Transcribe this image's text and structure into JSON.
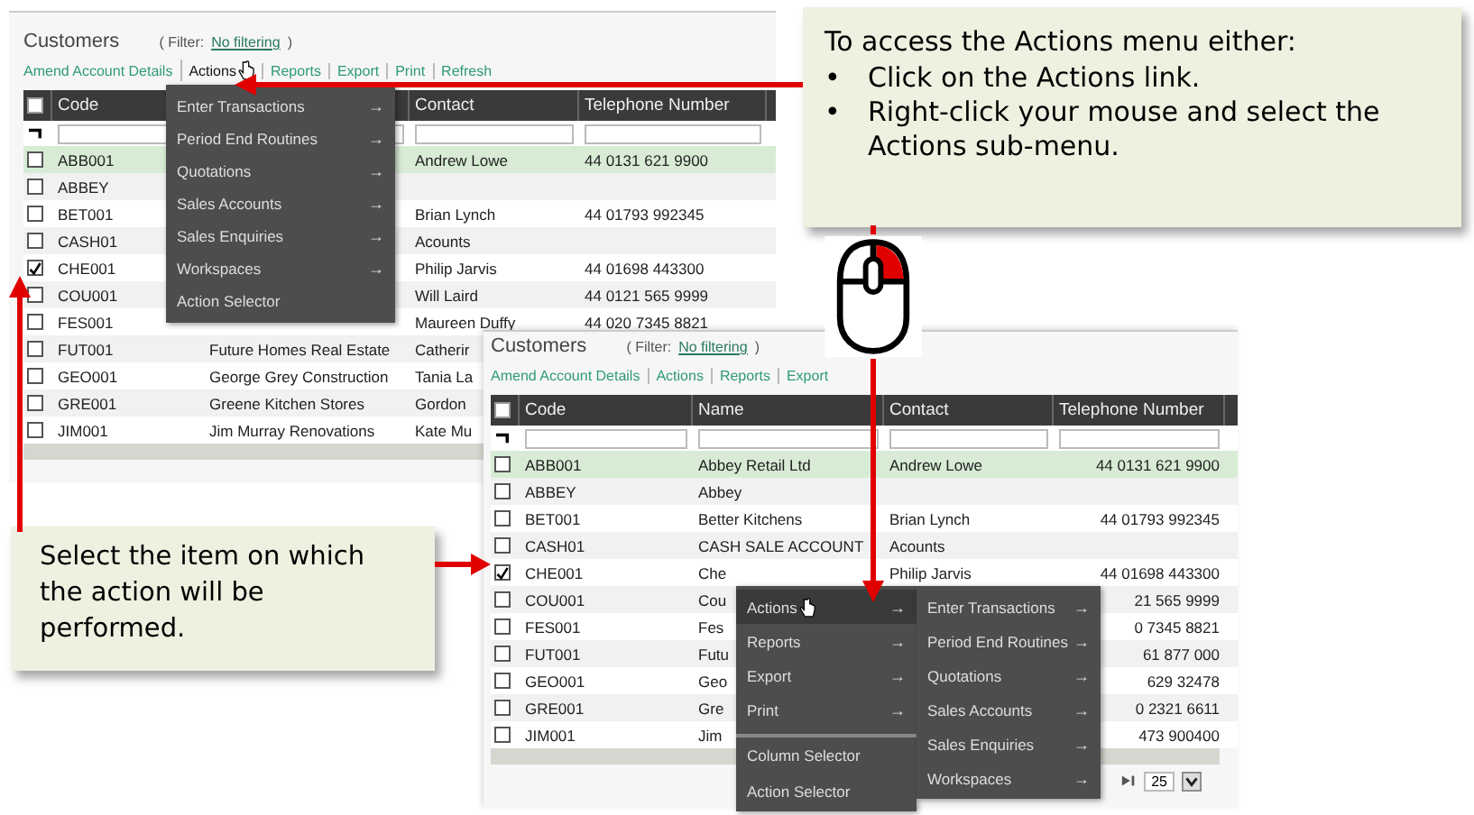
{
  "screenshot_1": {
    "title": "Customers",
    "filter_label": "( Filter:",
    "filter_link": "No filtering",
    "filter_end": ")",
    "toolbar": [
      {
        "label": "Amend Account Details",
        "selected": false
      },
      {
        "label": "Actions",
        "selected": true
      },
      {
        "label": "Reports",
        "selected": false
      },
      {
        "label": "Export",
        "selected": false
      },
      {
        "label": "Print",
        "selected": false
      },
      {
        "label": "Refresh",
        "selected": false
      }
    ],
    "header": {
      "code": "Code",
      "contact": "Contact",
      "telephone": "Telephone Number",
      "all_checked": false
    },
    "rows": [
      {
        "code": "ABB001",
        "contact": "Andrew Lowe",
        "telephone": "44 0131 621 9900",
        "checked": false,
        "selected": true
      },
      {
        "code": "ABBEY",
        "checked": false,
        "selected": false
      },
      {
        "code": "BET001",
        "contact": "Brian Lynch",
        "telephone": "44 01793 992345",
        "checked": false,
        "selected": false
      },
      {
        "code": "CASH01",
        "contact": "Acounts",
        "checked": false,
        "selected": false
      },
      {
        "code": "CHE001",
        "contact": "Philip Jarvis",
        "telephone": "44 01698 443300",
        "checked": true,
        "selected": false
      },
      {
        "code": "COU001",
        "contact": "Will Laird",
        "telephone": "44 0121 565 9999",
        "checked": false,
        "selected": false
      },
      {
        "code": "FES001",
        "contact": "Maureen Duffy",
        "telephone": "44 020 7345 8821",
        "checked": false,
        "selected": false
      },
      {
        "code": "FUT001",
        "name": "Future Homes Real Estate",
        "contact": "Catherir",
        "checked": false,
        "selected": false
      },
      {
        "code": "GEO001",
        "name": "George Grey Construction",
        "contact": "Tania La",
        "checked": false,
        "selected": false
      },
      {
        "code": "GRE001",
        "name": "Greene Kitchen Stores",
        "contact": "Gordon",
        "checked": false,
        "selected": false
      },
      {
        "code": "JIM001",
        "name": "Jim Murray Renovations",
        "contact": "Kate Mu",
        "checked": false,
        "selected": false
      }
    ],
    "actions_menu": {
      "items": [
        {
          "label": "Enter Transactions",
          "arrow": "→"
        },
        {
          "label": "Period End Routines",
          "arrow": "→"
        },
        {
          "label": "Quotations",
          "arrow": "→"
        },
        {
          "label": "Sales Accounts",
          "arrow": "→"
        },
        {
          "label": "Sales Enquiries",
          "arrow": "→"
        },
        {
          "label": "Workspaces",
          "arrow": "→"
        },
        {
          "label": "Action Selector"
        }
      ]
    }
  },
  "screenshot_2": {
    "title": "Customers",
    "filter_label": "( Filter:",
    "filter_link": "No filtering",
    "filter_end": ")",
    "toolbar": [
      {
        "label": "Amend Account Details",
        "selected": false
      },
      {
        "label": "Actions",
        "selected": false
      },
      {
        "label": "Reports",
        "selected": false
      },
      {
        "label": "Export",
        "selected": false
      }
    ],
    "header": {
      "code": "Code",
      "name": "Name",
      "contact": "Contact",
      "telephone": "Telephone Number",
      "all_checked": false
    },
    "rows": [
      {
        "code": "ABB001",
        "name": "Abbey Retail Ltd",
        "contact": "Andrew Lowe",
        "telephone": "44 0131 621 9900",
        "checked": false,
        "selected": true
      },
      {
        "code": "ABBEY",
        "name": "Abbey",
        "checked": false,
        "selected": false
      },
      {
        "code": "BET001",
        "name": "Better Kitchens",
        "contact": "Brian Lynch",
        "telephone": "44 01793 992345",
        "checked": false,
        "selected": false
      },
      {
        "code": "CASH01",
        "name": "CASH SALE ACCOUNT",
        "contact": "Acounts",
        "checked": false,
        "selected": false
      },
      {
        "code": "CHE001",
        "name": "Che",
        "contact": "Philip Jarvis",
        "telephone": "44 01698 443300",
        "checked": true,
        "selected": false
      },
      {
        "code": "COU001",
        "name": "Cou",
        "telephone": "21 565 9999",
        "checked": false,
        "selected": false
      },
      {
        "code": "FES001",
        "name": "Fes",
        "telephone": "0 7345 8821",
        "checked": false,
        "selected": false
      },
      {
        "code": "FUT001",
        "name": "Futu",
        "telephone": "61 877 000",
        "checked": false,
        "selected": false
      },
      {
        "code": "GEO001",
        "name": "Geo",
        "telephone": "629 32478",
        "checked": false,
        "selected": false
      },
      {
        "code": "GRE001",
        "name": "Gre",
        "telephone": "0 2321 6611",
        "checked": false,
        "selected": false
      },
      {
        "code": "JIM001",
        "name": "Jim",
        "telephone": "473 900400",
        "checked": false,
        "selected": false
      }
    ],
    "context_menu": {
      "items": [
        {
          "label": "Actions",
          "arrow": "→",
          "selected": true,
          "separated": false
        },
        {
          "label": "Reports",
          "arrow": "→",
          "selected": false,
          "separated": false
        },
        {
          "label": "Export",
          "arrow": "→",
          "selected": false,
          "separated": false
        },
        {
          "label": "Print",
          "arrow": "→",
          "selected": false,
          "separated": false
        },
        {
          "label": "Column Selector",
          "selected": false,
          "separated": true
        },
        {
          "label": "Action Selector",
          "selected": false,
          "separated": false
        }
      ]
    },
    "submenu": {
      "items": [
        {
          "label": "Enter Transactions",
          "arrow": "→"
        },
        {
          "label": "Period End Routines",
          "arrow": "→"
        },
        {
          "label": "Quotations",
          "arrow": "→"
        },
        {
          "label": "Sales Accounts",
          "arrow": "→"
        },
        {
          "label": "Sales Enquiries",
          "arrow": "→"
        },
        {
          "label": "Workspaces",
          "arrow": "→"
        }
      ]
    },
    "page_size": "25"
  },
  "top_callout": {
    "heading": "To access the Actions menu either:",
    "bullets": [
      {
        "bullet": "•",
        "text": "Click on the Actions link."
      },
      {
        "bullet": "•",
        "text": "Right-click your mouse and select the Actions sub-menu."
      }
    ]
  },
  "bottom_callout": {
    "text": "Select the item on which the action will be performed."
  }
}
